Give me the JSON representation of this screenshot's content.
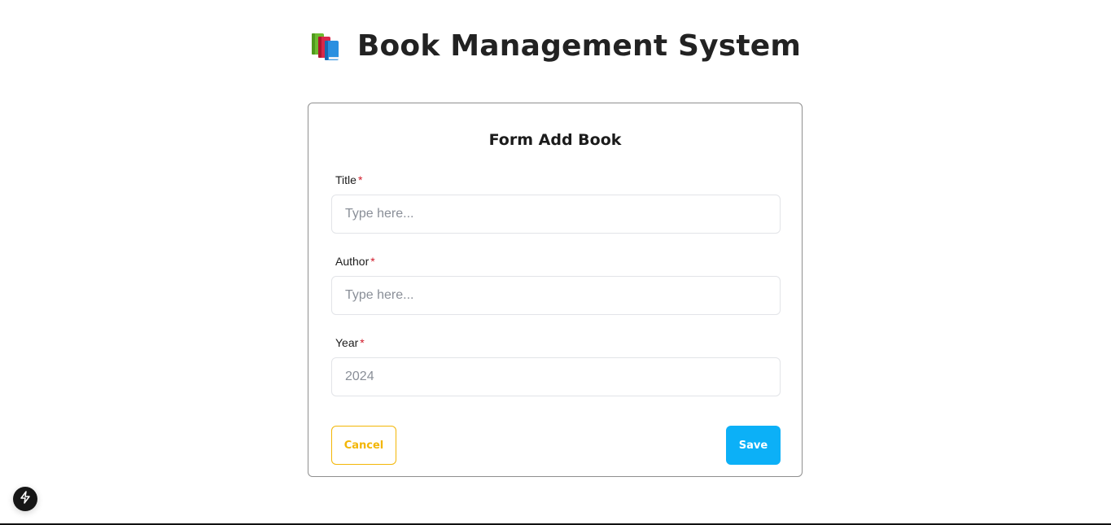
{
  "header": {
    "title": "Book Management System",
    "icon": "books-icon"
  },
  "form": {
    "title": "Form Add Book",
    "required_marker": "*",
    "fields": [
      {
        "label": "Title",
        "placeholder": "Type here...",
        "value": ""
      },
      {
        "label": "Author",
        "placeholder": "Type here...",
        "value": ""
      },
      {
        "label": "Year",
        "placeholder": "2024",
        "value": ""
      }
    ],
    "cancel_label": "Cancel",
    "save_label": "Save"
  },
  "colors": {
    "cancel": "#f3b606",
    "save": "#0cb0f7",
    "required": "#d11a2a"
  },
  "dev_indicator": {
    "icon": "lightning-icon"
  }
}
